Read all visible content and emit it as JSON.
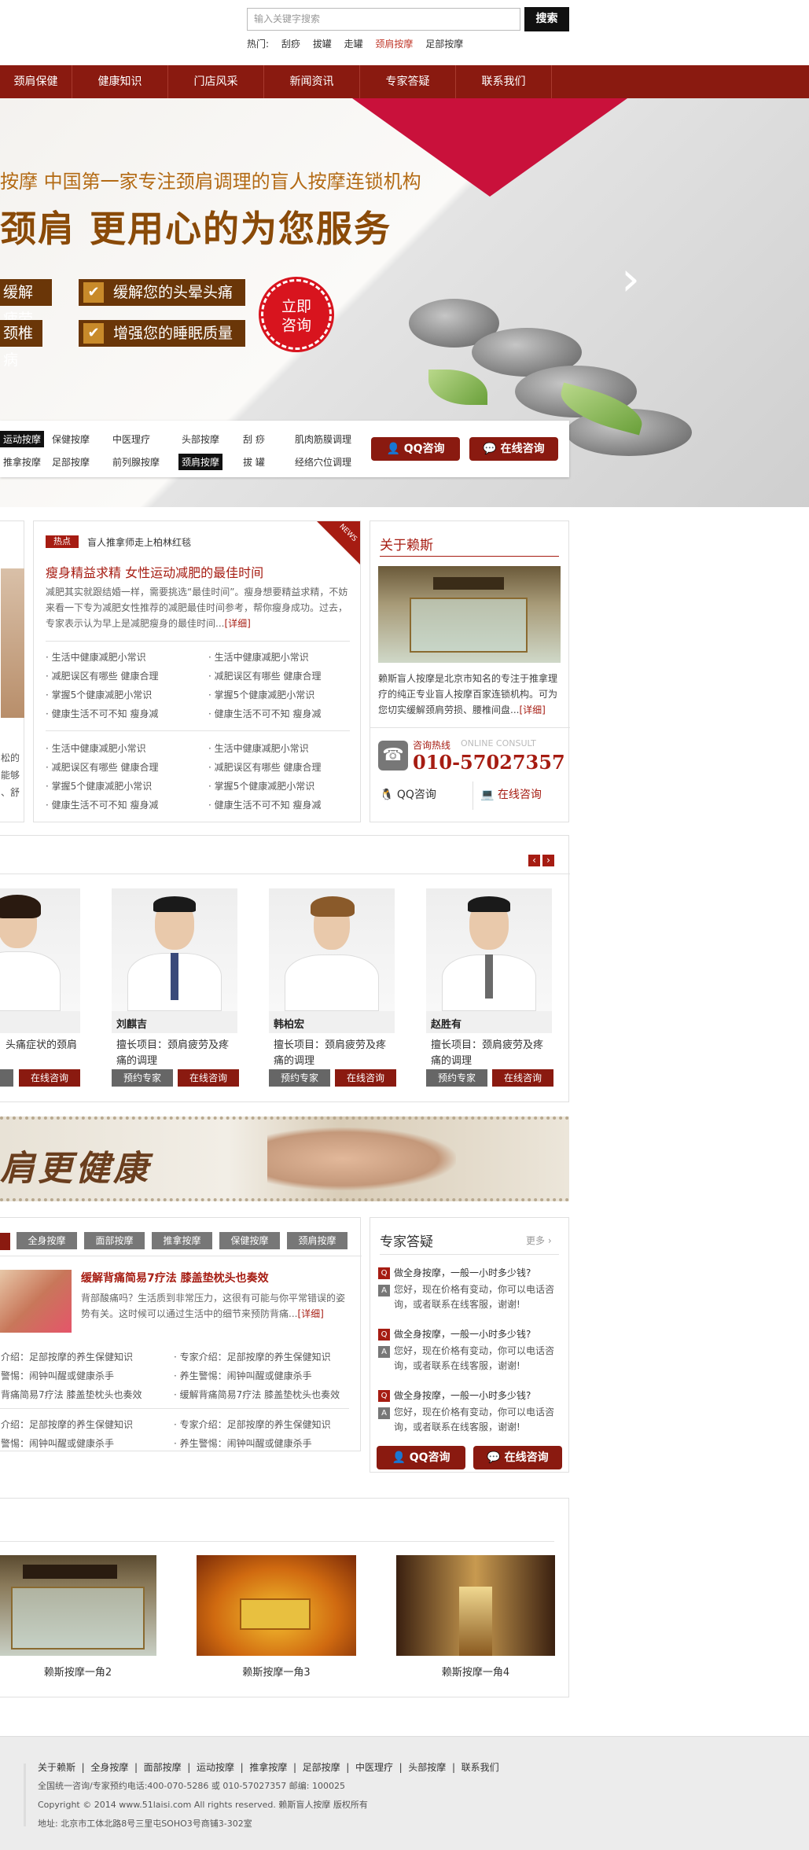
{
  "search": {
    "placeholder": "输入关键字搜索",
    "button": "搜索",
    "hot_label": "热门:",
    "hot": [
      "刮痧",
      "拔罐",
      "走罐",
      "颈肩按摩",
      "足部按摩"
    ]
  },
  "nav": [
    "颈肩保健",
    "健康知识",
    "门店风采",
    "新闻资讯",
    "专家答疑",
    "联系我们"
  ],
  "banner": {
    "subtitle": "按摩  中国第一家专注颈肩调理的盲人按摩连锁机构",
    "title": "颈肩 更用心的为您服务",
    "tags": [
      "缓解疲劳",
      "缓解您的头晕头痛",
      "颈椎病",
      "增强您的睡眠质量"
    ],
    "circle": [
      "立即",
      "咨询"
    ]
  },
  "quick": {
    "row1": [
      "运动按摩",
      "保健按摩",
      "中医理疗",
      "头部按摩",
      "刮  痧",
      "肌肉筋膜调理"
    ],
    "row2": [
      "推拿按摩",
      "足部按摩",
      "前列腺按摩",
      "颈肩按摩",
      "拔  罐",
      "经络穴位调理"
    ],
    "qq": "QQ咨询",
    "online": "在线咨询"
  },
  "news": {
    "hot_badge": "热点",
    "hot_title": "盲人推拿师走上柏林红毯",
    "corner": "NEWS",
    "headline": "瘦身精益求精 女性运动减肥的最佳时间",
    "summary": "减肥其实就跟结婚一样，需要挑选“最佳时间”。瘦身想要精益求精，不妨来看一下专为减肥女性推荐的减肥最佳时间参考，帮你瘦身成功。过去，专家表示认为早上是减肥瘦身的最佳时间...",
    "detail": "[详细]",
    "list": [
      "生活中健康减肥小常识",
      "减肥误区有哪些  健康合理",
      "掌握5个健康减肥小常识",
      "健康生活不可不知  瘦身减"
    ]
  },
  "left_partial": [
    "松的",
    "能够",
    "、舒"
  ],
  "about": {
    "title": "关于赖斯",
    "text": "赖斯盲人按摩是北京市知名的专注于推拿理疗的纯正专业盲人按摩百家连锁机构。可为您切实缓解颈肩劳损、腰椎间盘...",
    "detail": "[详细]",
    "hotline_label": "咨询热线",
    "hotline_en": "ONLINE CONSULT",
    "phone": "010-57027357",
    "qq": "QQ咨询",
    "online": "在线咨询"
  },
  "doctors": [
    {
      "name": "",
      "desc": "头痛症状的颈肩",
      "btn1": "",
      "btn2": "在线咨询"
    },
    {
      "name": "刘麒吉",
      "desc": "擅长项目：颈肩疲劳及疼痛的调理",
      "btn1": "预约专家",
      "btn2": "在线咨询"
    },
    {
      "name": "韩柏宏",
      "desc": "擅长项目：颈肩疲劳及疼痛的调理",
      "btn1": "预约专家",
      "btn2": "在线咨询"
    },
    {
      "name": "赵胜有",
      "desc": "擅长项目：颈肩疲劳及疼痛的调理",
      "btn1": "预约专家",
      "btn2": "在线咨询"
    }
  ],
  "health_banner": "肩更健康",
  "tabs": [
    "全身按摩",
    "面部按摩",
    "推拿按摩",
    "保健按摩",
    "颈肩按摩"
  ],
  "article": {
    "title": "缓解背痛简易7疗法  膝盖垫枕头也奏效",
    "summary": "背部酸痛吗？生活质到非常压力，这很有可能与你平常错误的姿势有关。这时候可以通过生活中的细节来预防背痛...",
    "detail": "[详细]",
    "list_left": [
      "介绍：足部按摩的养生保健知识",
      "警惕：闹钟叫醒或健康杀手",
      "背痛简易7疗法  膝盖垫枕头也奏效"
    ],
    "list_right": [
      "专家介绍：足部按摩的养生保健知识",
      "养生警惕：闹钟叫醒或健康杀手",
      "缓解背痛简易7疗法  膝盖垫枕头也奏效"
    ]
  },
  "qa": {
    "title": "专家答疑",
    "more": "更多",
    "q": "做全身按摩，一般一小时多少钱?",
    "a": "您好，现在价格有变动，你可以电话咨询，或者联系在线客服，谢谢!",
    "qq": "QQ咨询",
    "online": "在线咨询"
  },
  "stores": [
    "赖斯按摩一角2",
    "赖斯按摩一角3",
    "赖斯按摩一角4"
  ],
  "footer": {
    "links": [
      "关于赖斯",
      "全身按摩",
      "面部按摩",
      "运动按摩",
      "推拿按摩",
      "足部按摩",
      "中医理疗",
      "头部按摩",
      "联系我们"
    ],
    "line1": "全国统一咨询/专家预约电话:400-070-5286 或 010-57027357 邮编: 100025",
    "line2": "Copyright © 2014 www.51laisi.com All rights reserved. 赖斯盲人按摩 版权所有",
    "line3": "地址: 北京市工体北路8号三里屯SOHO3号商铺3-302室"
  }
}
